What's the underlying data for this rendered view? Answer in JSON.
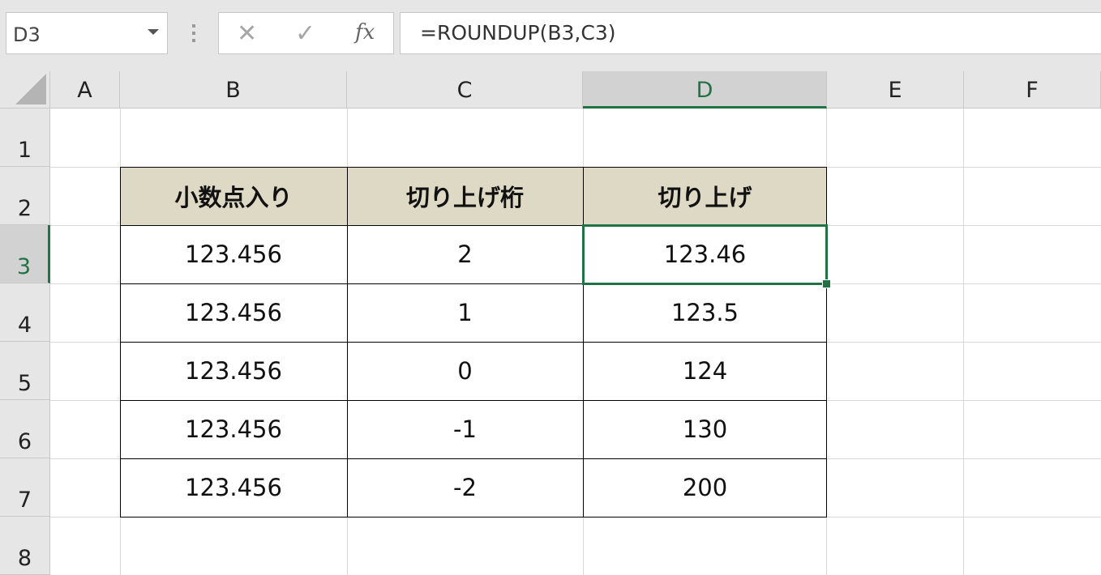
{
  "namebox": {
    "value": "D3"
  },
  "formula_bar": {
    "cancel_icon": "✕",
    "enter_icon": "✓",
    "fx_label": "fx",
    "formula": "=ROUNDUP(B3,C3)"
  },
  "columns": [
    "A",
    "B",
    "C",
    "D",
    "E",
    "F"
  ],
  "rows": [
    "1",
    "2",
    "3",
    "4",
    "5",
    "6",
    "7",
    "8"
  ],
  "selected": {
    "column": "D",
    "row": "3",
    "accent": "#217346"
  },
  "table": {
    "header_fill": "#ddd9c4",
    "headers": [
      "小数点入り",
      "切り上げ桁",
      "切り上げ"
    ],
    "rows": [
      [
        "123.456",
        "2",
        "123.46"
      ],
      [
        "123.456",
        "1",
        "123.5"
      ],
      [
        "123.456",
        "0",
        "124"
      ],
      [
        "123.456",
        "-1",
        "130"
      ],
      [
        "123.456",
        "-2",
        "200"
      ]
    ]
  }
}
